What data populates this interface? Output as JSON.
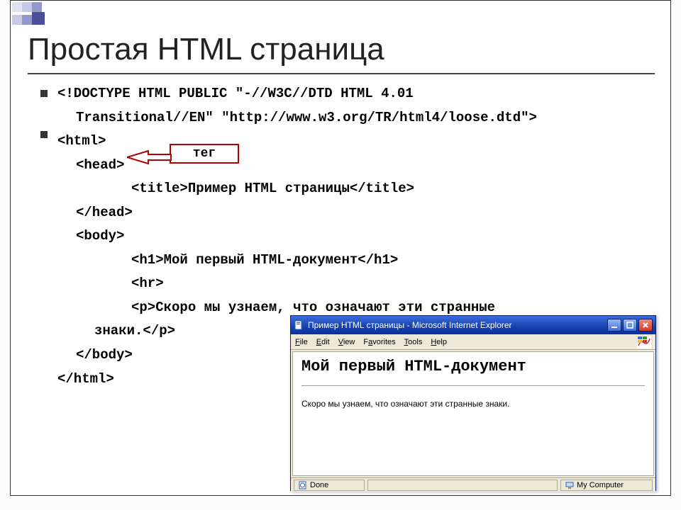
{
  "slide": {
    "title": "Простая HTML страница"
  },
  "code": {
    "l1a": "<!DOCTYPE HTML PUBLIC \"-//W3C//DTD HTML 4.01",
    "l1b": "Transitional//EN\" \"http://www.w3.org/TR/html4/loose.dtd\">",
    "l2": "<html>",
    "l3": "<head>",
    "l4": "<title>Пример HTML страницы</title>",
    "l5": "</head>",
    "l6": "<body>",
    "l7": "<h1>Мой первый HTML-документ</h1>",
    "l8": "<hr>",
    "l9a": "<p>Скоро мы узнаем, что означают эти странные",
    "l9b": "знаки.</p>",
    "l10": "</body>",
    "l11": "</html>"
  },
  "callout": {
    "label": "тег"
  },
  "browser": {
    "title": "Пример HTML страницы - Microsoft Internet Explorer",
    "menu": {
      "file": "File",
      "edit": "Edit",
      "view": "View",
      "favorites": "Favorites",
      "tools": "Tools",
      "help": "Help"
    },
    "page": {
      "heading": "Мой первый HTML-документ",
      "paragraph": "Скоро мы узнаем, что означают эти странные знаки."
    },
    "status": {
      "left": "Done",
      "right": "My Computer"
    }
  }
}
